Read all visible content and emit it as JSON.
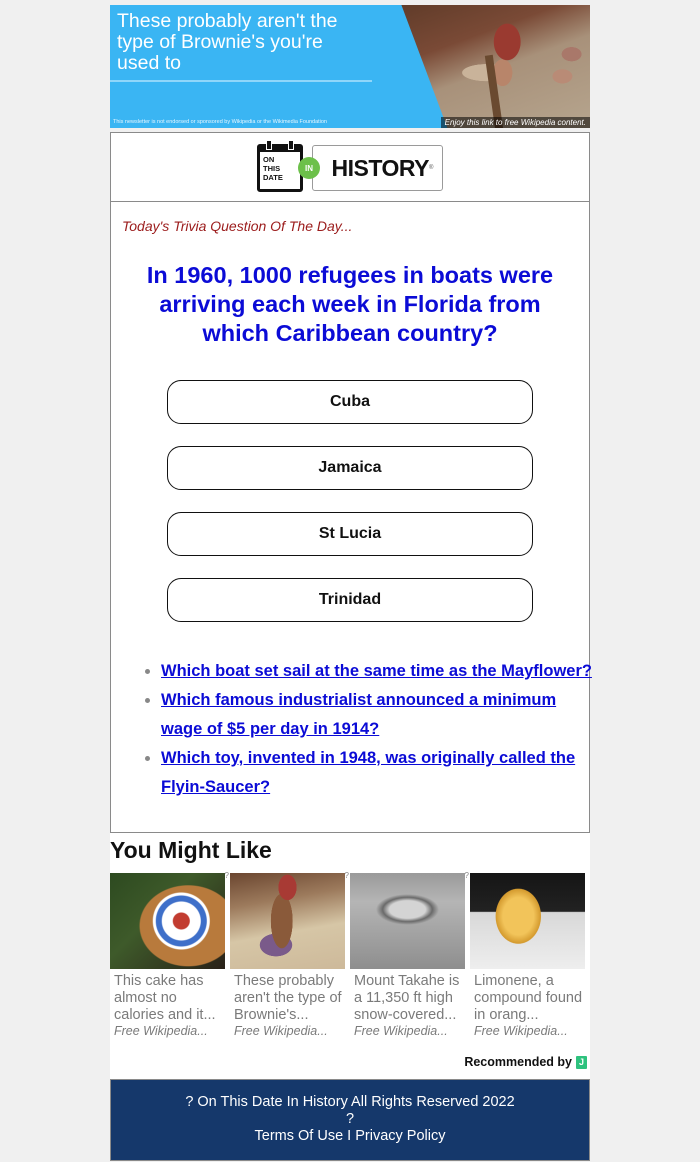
{
  "banner": {
    "headline": "These probably aren't the type of Brownie's you're used to",
    "disclaimer": "This newsletter is not endorsed or sponsored by Wikipedia or the Wikimedia Foundation",
    "caption": "Enjoy this link to free Wikipedia content.",
    "bg_color": "#3ab5f3"
  },
  "logo": {
    "calendar_text": [
      "ON",
      "THIS",
      "DATE"
    ],
    "badge": "IN",
    "word": "HISTORY",
    "mark": "®",
    "badge_color": "#6cc04a"
  },
  "trivia": {
    "label": "Today's Trivia Question Of The Day...",
    "question": "In 1960, 1000 refugees in boats were arriving each week in Florida from which Caribbean country?",
    "answers": [
      "Cuba",
      "Jamaica",
      "St Lucia",
      "Trinidad"
    ],
    "question_color": "#0b0bd6",
    "label_color": "#9b1b1b"
  },
  "more_questions": [
    "Which boat set sail at the same time as the Mayflower?",
    "Which famous industrialist announced a minimum wage of $5 per day in 1914?",
    "Which toy, invented in 1948, was originally called the Flyin-Saucer?"
  ],
  "recommendations": {
    "heading": "You Might Like",
    "items": [
      {
        "title": "This cake has almost no calories and it...",
        "source": "Free Wikipedia...",
        "image": "plated-dessert",
        "marker": "?"
      },
      {
        "title": "These probably aren't the type of Brownie's...",
        "source": "Free Wikipedia...",
        "image": "brownie-illustration",
        "marker": "?"
      },
      {
        "title": "Mount Takahe is a 11,350 ft high snow-covered...",
        "source": "Free Wikipedia...",
        "image": "mountain-aerial",
        "marker": "?"
      },
      {
        "title": "Limonene, a compound found in orang...",
        "source": "Free Wikipedia...",
        "image": "yellow-fruit",
        "marker": "?"
      }
    ],
    "recommended_by": "Recommended by",
    "provider_icon": "J"
  },
  "footer": {
    "copyright": "? On This Date In History All Rights Reserved 2022",
    "separator": "?",
    "terms": "Terms Of Use",
    "divider": "I",
    "privacy": "Privacy Policy",
    "bg_color": "#15386b"
  }
}
